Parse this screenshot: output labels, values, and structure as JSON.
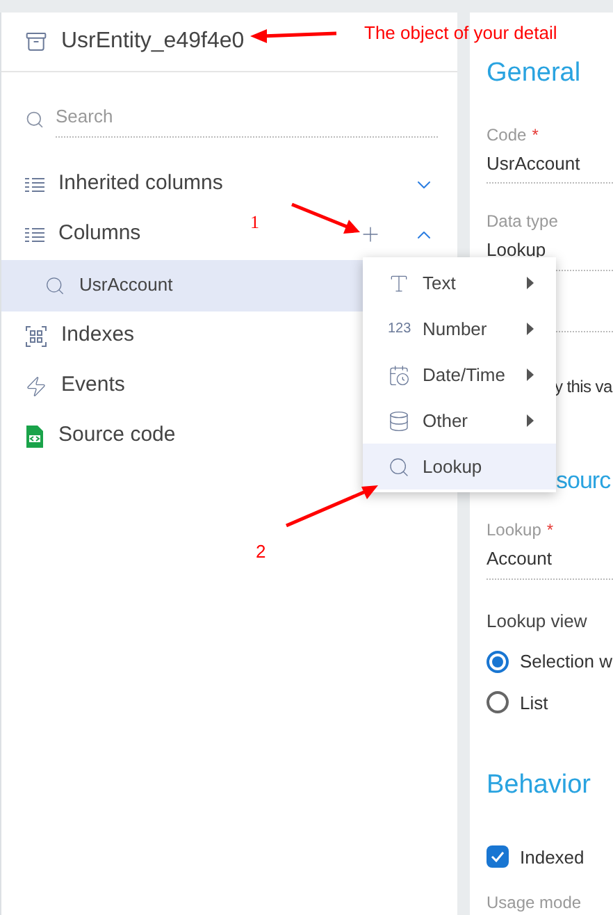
{
  "header": {
    "title": "UsrEntity_e49f4e0"
  },
  "search": {
    "placeholder": "Search"
  },
  "tree": [
    {
      "label": "Inherited columns",
      "kind": "columns",
      "expanded": false,
      "can_add": false
    },
    {
      "label": "Columns",
      "kind": "columns",
      "expanded": true,
      "can_add": true,
      "children": [
        {
          "label": "UsrAccount",
          "selected": true
        }
      ]
    },
    {
      "label": "Indexes",
      "kind": "indexes"
    },
    {
      "label": "Events",
      "kind": "events"
    },
    {
      "label": "Source code",
      "kind": "source"
    }
  ],
  "add_menu": [
    {
      "label": "Text",
      "kind": "text",
      "submenu": true,
      "selected": false
    },
    {
      "label": "Number",
      "kind": "number",
      "icon_text": "123",
      "submenu": true,
      "selected": false
    },
    {
      "label": "Date/Time",
      "kind": "datetime",
      "submenu": true,
      "selected": false
    },
    {
      "label": "Other",
      "kind": "other",
      "submenu": true,
      "selected": false
    },
    {
      "label": "Lookup",
      "kind": "lookup",
      "submenu": false,
      "selected": true
    }
  ],
  "details": {
    "general": {
      "heading": "General",
      "fields": [
        {
          "label": "Code",
          "required_mark": "*",
          "value": "UsrAccount"
        },
        {
          "label": "Data type",
          "value": "Lookup"
        }
      ],
      "partial_text": "y this va"
    },
    "source": {
      "heading": "sourc",
      "lookup": {
        "label": "Lookup",
        "required_mark": "*",
        "value": "Account"
      },
      "lookup_view": {
        "label": "Lookup view",
        "options": [
          {
            "label": "Selection w",
            "selected": true
          },
          {
            "label": "List",
            "selected": false
          }
        ]
      }
    },
    "behavior": {
      "heading": "Behavior",
      "indexed": {
        "label": "Indexed",
        "checked": true
      },
      "usage_mode_label": "Usage mode"
    }
  },
  "annotations": [
    {
      "text": "The object of your detail"
    },
    {
      "text": "1"
    },
    {
      "text": "2"
    }
  ]
}
